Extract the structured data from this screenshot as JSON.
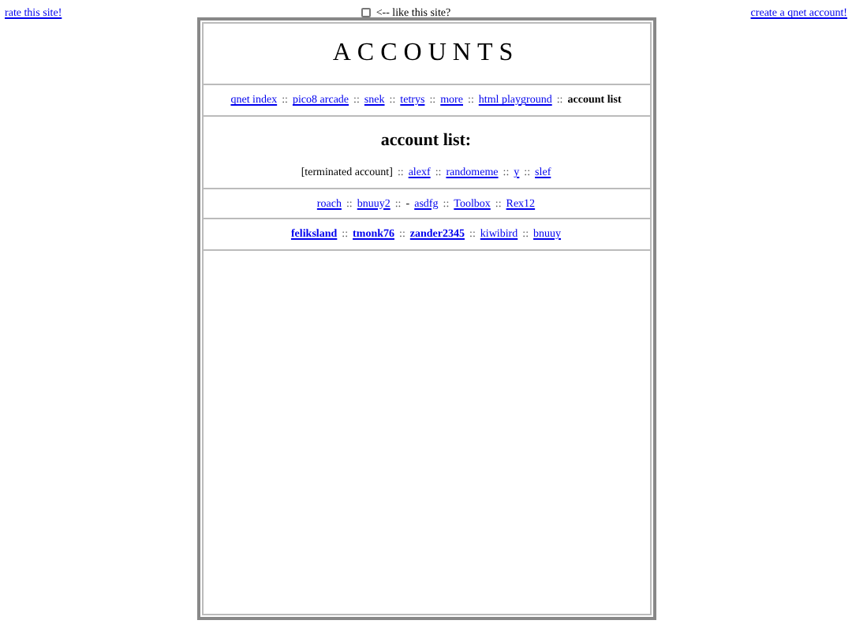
{
  "top_bar": {
    "rate_link": "rate this site!",
    "like": {
      "checked": false,
      "label": "<-- like this site?"
    },
    "create_link": "create a qnet account!"
  },
  "title": "ACCOUNTS",
  "nav": {
    "separator": "::",
    "items": [
      {
        "label": "qnet index",
        "selected": false
      },
      {
        "label": "pico8 arcade",
        "selected": false
      },
      {
        "label": "snek",
        "selected": false
      },
      {
        "label": "tetrys",
        "selected": false
      },
      {
        "label": "more",
        "selected": false
      },
      {
        "label": "html playground",
        "selected": false
      },
      {
        "label": "account list",
        "selected": true
      }
    ]
  },
  "heading": "account list:",
  "account_rows": [
    {
      "items": [
        {
          "kind": "text",
          "label": "[terminated account]"
        },
        {
          "kind": "link",
          "label": "alexf"
        },
        {
          "kind": "link",
          "label": "randomeme"
        },
        {
          "kind": "link",
          "label": "y"
        },
        {
          "kind": "link",
          "label": "slef"
        }
      ]
    },
    {
      "items": [
        {
          "kind": "link",
          "label": "roach"
        },
        {
          "kind": "link",
          "label": "bnuuy2"
        },
        {
          "kind": "link",
          "prefix": "-",
          "label": "asdfg"
        },
        {
          "kind": "link",
          "label": "Toolbox"
        },
        {
          "kind": "link",
          "label": "Rex12"
        }
      ]
    },
    {
      "items": [
        {
          "kind": "bold",
          "label": "feliksland"
        },
        {
          "kind": "bold",
          "label": "tmonk76"
        },
        {
          "kind": "bold",
          "label": "zander2345"
        },
        {
          "kind": "link",
          "label": "kiwibird"
        },
        {
          "kind": "link",
          "label": "bnuuy"
        }
      ]
    }
  ],
  "row_separator": "::"
}
